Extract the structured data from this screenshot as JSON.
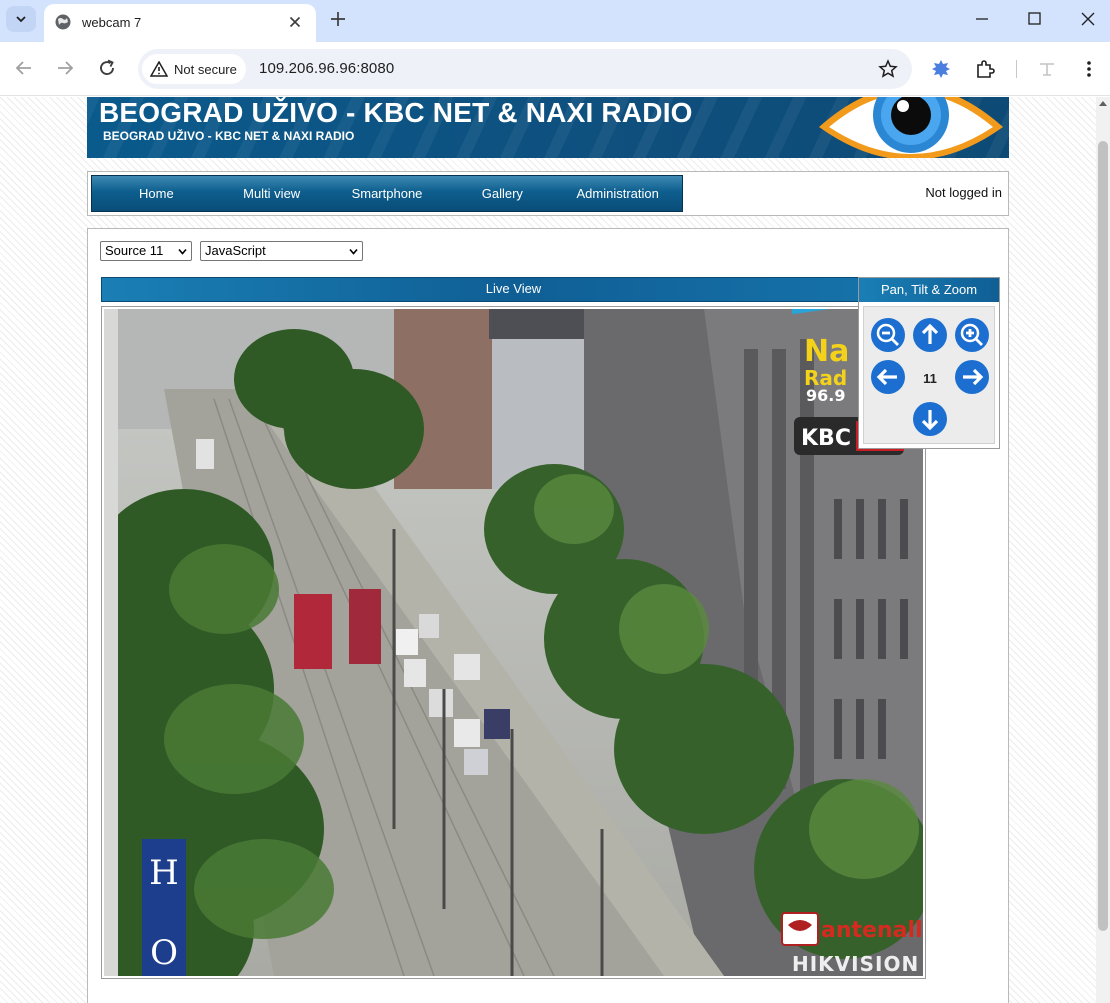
{
  "browser": {
    "tab_title": "webcam 7",
    "security_label": "Not secure",
    "url": "109.206.96.96:8080"
  },
  "site": {
    "title": "BEOGRAD UŽIVO - KBC NET & NAXI RADIO",
    "subtitle": "BEOGRAD UŽIVO - KBC NET & NAXI RADIO"
  },
  "menu": {
    "items": [
      "Home",
      "Multi view",
      "Smartphone",
      "Gallery",
      "Administration"
    ],
    "login_status": "Not logged in"
  },
  "controls": {
    "source_select": "Source 11",
    "mode_select": "JavaScript"
  },
  "live_view": {
    "header": "Live View",
    "watermark_brand": "antenall",
    "watermark_vendor": "HIKVISION",
    "station_logo": "Na Rad 96.9",
    "station_badge": "KBC"
  },
  "ptz": {
    "title": "Pan, Tilt & Zoom",
    "source_number": "11",
    "buttons": [
      "zoom-out-icon",
      "arrow-up-icon",
      "zoom-in-icon",
      "arrow-left-icon",
      "arrow-right-icon",
      "arrow-down-icon"
    ]
  },
  "colors": {
    "brand_blue": "#0f4f7d",
    "menu_blue": "#0d5e8e",
    "button_blue": "#1c6fd1",
    "tab_strip": "#d3e3fd"
  }
}
